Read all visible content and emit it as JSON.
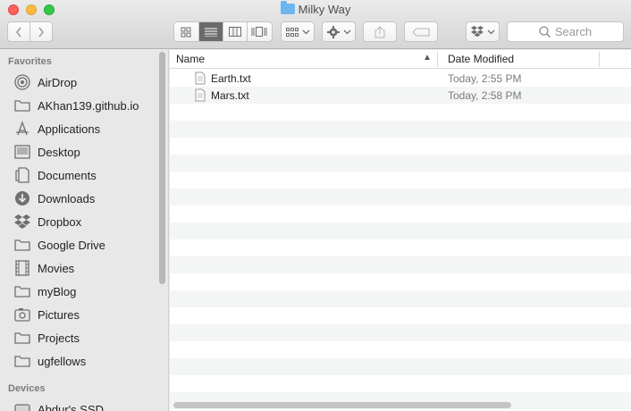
{
  "window": {
    "title": "Milky Way"
  },
  "toolbar": {
    "back_icon": "chevron-left-icon",
    "forward_icon": "chevron-right-icon",
    "view_modes": [
      "icon-view-icon",
      "list-view-icon",
      "column-view-icon",
      "coverflow-view-icon"
    ],
    "active_view": "list",
    "search_placeholder": "Search"
  },
  "sidebar": {
    "favorites_header": "Favorites",
    "favorites": [
      {
        "label": "AirDrop",
        "icon": "airdrop-icon"
      },
      {
        "label": "AKhan139.github.io",
        "icon": "folder-icon"
      },
      {
        "label": "Applications",
        "icon": "applications-icon"
      },
      {
        "label": "Desktop",
        "icon": "desktop-icon"
      },
      {
        "label": "Documents",
        "icon": "documents-icon"
      },
      {
        "label": "Downloads",
        "icon": "downloads-icon"
      },
      {
        "label": "Dropbox",
        "icon": "dropbox-icon"
      },
      {
        "label": "Google Drive",
        "icon": "folder-icon"
      },
      {
        "label": "Movies",
        "icon": "movies-icon"
      },
      {
        "label": "myBlog",
        "icon": "folder-icon"
      },
      {
        "label": "Pictures",
        "icon": "pictures-icon"
      },
      {
        "label": "Projects",
        "icon": "folder-icon"
      },
      {
        "label": "ugfellows",
        "icon": "folder-icon"
      }
    ],
    "devices_header": "Devices",
    "devices": [
      {
        "label": "Abdur's SSD",
        "icon": "disk-icon"
      }
    ]
  },
  "list": {
    "columns": {
      "name": "Name",
      "date": "Date Modified"
    },
    "files": [
      {
        "name": "Earth.txt",
        "date": "Today, 2:55 PM"
      },
      {
        "name": "Mars.txt",
        "date": "Today, 2:58 PM"
      }
    ]
  },
  "colors": {
    "accent": "#6cb6f0",
    "close": "#fc605b",
    "minimize": "#fdbc40",
    "maximize": "#34c84a"
  }
}
